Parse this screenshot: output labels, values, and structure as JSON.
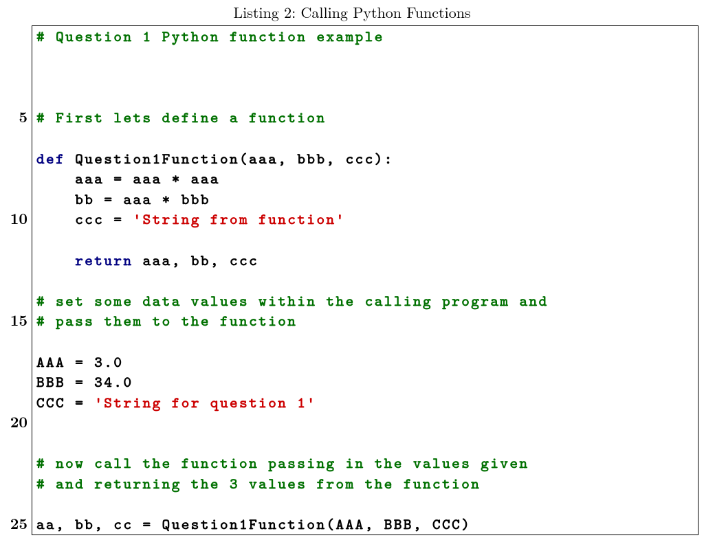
{
  "caption": "Listing 2: Calling Python Functions",
  "line_number_interval": 5,
  "code_lines": [
    [
      {
        "type": "comment",
        "text": "# Question 1 Python function example"
      }
    ],
    [
      {
        "type": "default",
        "text": ""
      }
    ],
    [
      {
        "type": "default",
        "text": ""
      }
    ],
    [
      {
        "type": "default",
        "text": ""
      }
    ],
    [
      {
        "type": "comment",
        "text": "# First lets define a function"
      }
    ],
    [
      {
        "type": "default",
        "text": ""
      }
    ],
    [
      {
        "type": "keyword",
        "text": "def"
      },
      {
        "type": "default",
        "text": " Question1Function(aaa, bbb, ccc):"
      }
    ],
    [
      {
        "type": "default",
        "text": "    aaa = aaa * aaa"
      }
    ],
    [
      {
        "type": "default",
        "text": "    bb = aaa * bbb"
      }
    ],
    [
      {
        "type": "default",
        "text": "    ccc = "
      },
      {
        "type": "string",
        "text": "'String from function'"
      }
    ],
    [
      {
        "type": "default",
        "text": ""
      }
    ],
    [
      {
        "type": "default",
        "text": "    "
      },
      {
        "type": "keyword",
        "text": "return"
      },
      {
        "type": "default",
        "text": " aaa, bb, ccc"
      }
    ],
    [
      {
        "type": "default",
        "text": ""
      }
    ],
    [
      {
        "type": "comment",
        "text": "# set some data values within the calling program and"
      }
    ],
    [
      {
        "type": "comment",
        "text": "# pass them to the function"
      }
    ],
    [
      {
        "type": "default",
        "text": ""
      }
    ],
    [
      {
        "type": "default",
        "text": "AAA = 3.0"
      }
    ],
    [
      {
        "type": "default",
        "text": "BBB = 34.0"
      }
    ],
    [
      {
        "type": "default",
        "text": "CCC = "
      },
      {
        "type": "string",
        "text": "'String for question 1'"
      }
    ],
    [
      {
        "type": "default",
        "text": ""
      }
    ],
    [
      {
        "type": "default",
        "text": ""
      }
    ],
    [
      {
        "type": "comment",
        "text": "# now call the function passing in the values given"
      }
    ],
    [
      {
        "type": "comment",
        "text": "# and returning the 3 values from the function"
      }
    ],
    [
      {
        "type": "default",
        "text": ""
      }
    ],
    [
      {
        "type": "default",
        "text": "aa, bb, cc = Question1Function(AAA, BBB, CCC)"
      }
    ]
  ]
}
